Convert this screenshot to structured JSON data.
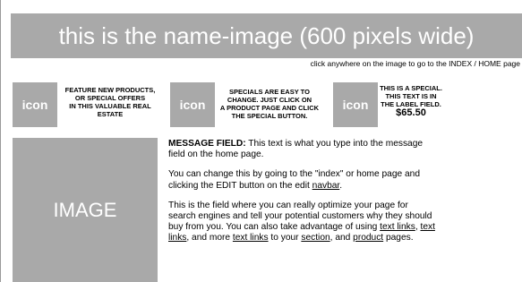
{
  "banner": {
    "text": "this is the name-image (600 pixels wide)"
  },
  "click_note": "click anywhere on the image to go to the INDEX / HOME page",
  "features": [
    {
      "icon_label": "icon",
      "line1": "FEATURE NEW PRODUCTS,",
      "line2": "OR SPECIAL OFFERS",
      "line3": "IN THIS VALUABLE REAL",
      "line4": "ESTATE"
    },
    {
      "icon_label": "icon",
      "line1": "SPECIALS ARE EASY TO",
      "line2": "CHANGE. JUST CLICK ON",
      "line3": "A PRODUCT PAGE AND CLICK",
      "line4": "THE SPECIAL BUTTON."
    },
    {
      "icon_label": "icon",
      "line1": "THIS IS A SPECIAL.",
      "line2": "THIS TEXT IS IN",
      "line3": "THE LABEL FIELD.",
      "price": "$65.50"
    }
  ],
  "image_placeholder": "IMAGE",
  "message": {
    "title": "MESSAGE FIELD:",
    "p1_rest": " This text is what you type into the message field on the home page.",
    "p2_before": "You can change this by going to the \"index\" or home page and clicking the EDIT button on the edit ",
    "p2_link": "navbar",
    "p2_after": ".",
    "p3_before": "This is the field where you can really optimize your page for search engines and tell your potential customers why they should buy from you. You can also take advantage of using ",
    "p3_link1": "text links",
    "p3_sep1": ", ",
    "p3_link2": "text links",
    "p3_sep2": ", and more ",
    "p3_link3": "text links",
    "p3_sep3": " to your ",
    "p3_link4": "section",
    "p3_sep4": ", and ",
    "p3_link5": "product",
    "p3_end": " pages."
  }
}
